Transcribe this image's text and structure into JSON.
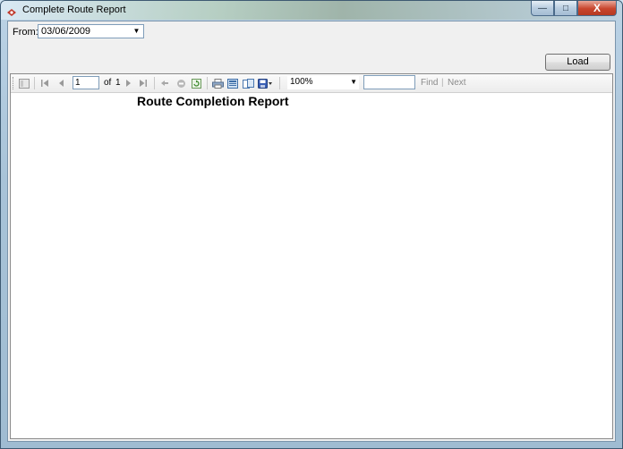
{
  "window": {
    "title": "Complete Route Report",
    "minimize_label": "—",
    "maximize_label": "□",
    "close_label": "X"
  },
  "form": {
    "from_label": "From:",
    "from_date": "03/06/2009",
    "load_label": "Load"
  },
  "viewer_toolbar": {
    "current_page": "1",
    "of_label": "of",
    "total_pages": "1",
    "zoom": "100%",
    "find_label": "Find",
    "find_separator": "|",
    "next_label": "Next"
  },
  "report": {
    "title": "Route Completion Report"
  },
  "colors": {
    "accent": "#1f5fbf",
    "close_red": "#c8452d"
  }
}
